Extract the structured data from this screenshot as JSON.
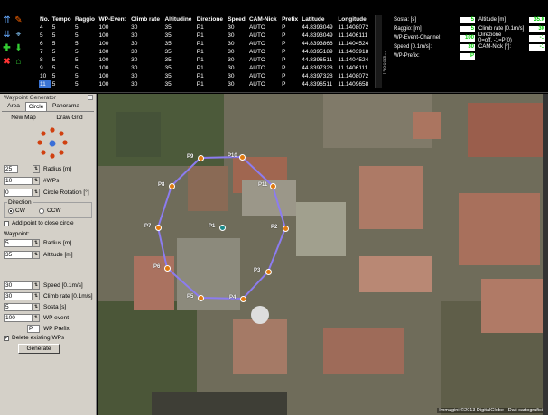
{
  "table": {
    "headers": [
      "No.",
      "Tempo",
      "Raggio",
      "WP-Event",
      "Climb rate",
      "Altitudine",
      "Direzione",
      "Speed",
      "CAM-Nick",
      "Prefix",
      "Latitude",
      "Longitude"
    ],
    "rows": [
      [
        "4",
        "5",
        "5",
        "100",
        "30",
        "35",
        "P1",
        "30",
        "AUTO",
        "P",
        "44.8393049",
        "11.1408072"
      ],
      [
        "5",
        "5",
        "5",
        "100",
        "30",
        "35",
        "P1",
        "30",
        "AUTO",
        "P",
        "44.8393049",
        "11.1406111"
      ],
      [
        "6",
        "5",
        "5",
        "100",
        "30",
        "35",
        "P1",
        "30",
        "AUTO",
        "P",
        "44.8393866",
        "11.1404524"
      ],
      [
        "7",
        "5",
        "5",
        "100",
        "30",
        "35",
        "P1",
        "30",
        "AUTO",
        "P",
        "44.8395189",
        "11.1403918"
      ],
      [
        "8",
        "5",
        "5",
        "100",
        "30",
        "35",
        "P1",
        "30",
        "AUTO",
        "P",
        "44.8396511",
        "11.1404524"
      ],
      [
        "9",
        "5",
        "5",
        "100",
        "30",
        "35",
        "P1",
        "30",
        "AUTO",
        "P",
        "44.8397328",
        "11.1406111"
      ],
      [
        "10",
        "5",
        "5",
        "100",
        "30",
        "35",
        "P1",
        "30",
        "AUTO",
        "P",
        "44.8397328",
        "11.1408072"
      ],
      [
        "11",
        "5",
        "5",
        "100",
        "30",
        "35",
        "P1",
        "30",
        "AUTO",
        "P",
        "44.8396511",
        "11.1409658"
      ]
    ],
    "selected_index": 7
  },
  "side_tab": "Precedi...",
  "params_left": [
    {
      "label": "Sosta: [s]",
      "value": "5"
    },
    {
      "label": "Raggio: [m]",
      "value": "5"
    },
    {
      "label": "WP-Event-Channel:",
      "value": "100"
    },
    {
      "label": "Speed [0.1m/s]:",
      "value": "30"
    },
    {
      "label": "WP-Prefix:",
      "value": "P"
    }
  ],
  "params_right": [
    {
      "label": "Altitude [m]",
      "value": "35.0"
    },
    {
      "label": "Climb rate [0.1m/s]",
      "value": "30"
    },
    {
      "label": "Direzione",
      "label2": "0=off, -1=P(0)",
      "value": "-1"
    },
    {
      "label": "CAM-Nick [°]:",
      "value": "-1"
    }
  ],
  "panel": {
    "title": "Waypoint Generator",
    "tabs": [
      "Area",
      "Circle",
      "Panorama"
    ],
    "new_map": "New Map",
    "draw_grid": "Draw Grid",
    "radius_value": "25",
    "radius_label": "Radius [m]",
    "wps_value": "10",
    "wps_label": "#WPs",
    "rotation_value": "0",
    "rotation_label": "Circle Rotation [°]",
    "direction_label": "Direction",
    "cw_label": "CW",
    "ccw_label": "CCW",
    "add_point_label": "Add point to close circle",
    "waypoint_label": "Waypoint:",
    "wp_radius_value": "5",
    "wp_radius_label": "Radius [m]",
    "altitude_value": "35",
    "altitude_label": "Altitude [m]",
    "speed_value": "30",
    "speed_label": "Speed [0.1m/s]",
    "climb_value": "30",
    "climb_label": "Climb rate [0.1m/s]",
    "sosta_value": "5",
    "sosta_label": "Sosta [s]",
    "event_value": "100",
    "event_label": "WP event",
    "prefix_value": "P",
    "prefix_label": "WP Prefix",
    "delete_label": "Delete existing WPs",
    "generate_label": "Generate"
  },
  "map": {
    "waypoints": [
      "P1",
      "P2",
      "P3",
      "P4",
      "P5",
      "P6",
      "P7",
      "P8",
      "P9",
      "P10",
      "P11"
    ],
    "attribution": "Immagini ©2013 DigitalGlobe - Dati cartografici"
  },
  "colors": {
    "accent": "#3a74d4",
    "value_green": "#00cc00",
    "route": "#8c7cf0",
    "wp": "#e07a10"
  }
}
